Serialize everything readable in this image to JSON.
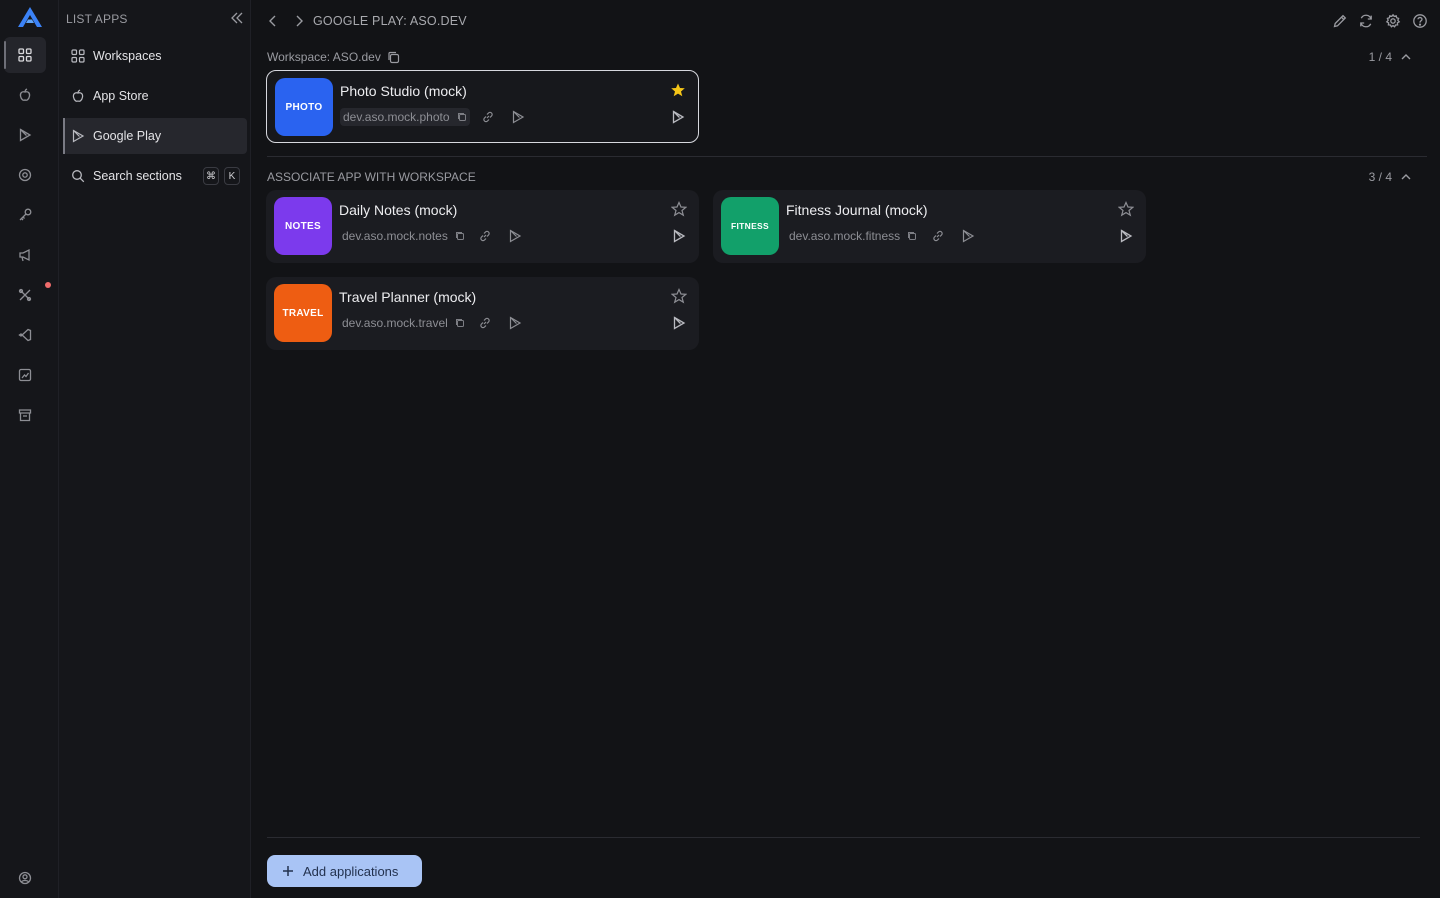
{
  "colors": {
    "accent_button": "#a9c4f5",
    "star_filled": "#f5c518",
    "background": "#121316"
  },
  "rail": {
    "items": [
      "apps-grid-icon",
      "apple-icon",
      "play-icon",
      "settings-target-icon",
      "key-icon",
      "megaphone-icon",
      "tools-icon",
      "vscode-icon",
      "chart-icon",
      "store-icon"
    ],
    "bottom": "account-icon"
  },
  "panel": {
    "title": "LIST APPS",
    "items": [
      {
        "label": "Workspaces",
        "icon": "grid-icon"
      },
      {
        "label": "App Store",
        "icon": "apple-icon"
      },
      {
        "label": "Google Play",
        "icon": "play-icon"
      },
      {
        "label": "Search sections",
        "icon": "search-icon"
      }
    ],
    "shortcut": {
      "mod": "⌘",
      "key": "K"
    }
  },
  "header": {
    "breadcrumb": "GOOGLE PLAY: ASO.DEV"
  },
  "workspace": {
    "label": "Workspace: ASO.dev",
    "counter": "1 / 4",
    "apps": [
      {
        "icon_text": "PHOTO",
        "icon_color": "#2a63f0",
        "name": "Photo Studio (mock)",
        "package": "dev.aso.mock.photo",
        "starred": true
      }
    ]
  },
  "associate": {
    "label": "ASSOCIATE APP WITH WORKSPACE",
    "counter": "3 / 4",
    "apps": [
      {
        "icon_text": "NOTES",
        "icon_color": "#7c3aed",
        "name": "Daily Notes (mock)",
        "package": "dev.aso.mock.notes",
        "starred": false
      },
      {
        "icon_text": "FITNESS",
        "icon_color": "#12a06a",
        "name": "Fitness Journal (mock)",
        "package": "dev.aso.mock.fitness",
        "starred": false
      },
      {
        "icon_text": "TRAVEL",
        "icon_color": "#ee5d12",
        "name": "Travel Planner (mock)",
        "package": "dev.aso.mock.travel",
        "starred": false
      }
    ]
  },
  "footer": {
    "add_button": "Add applications"
  }
}
